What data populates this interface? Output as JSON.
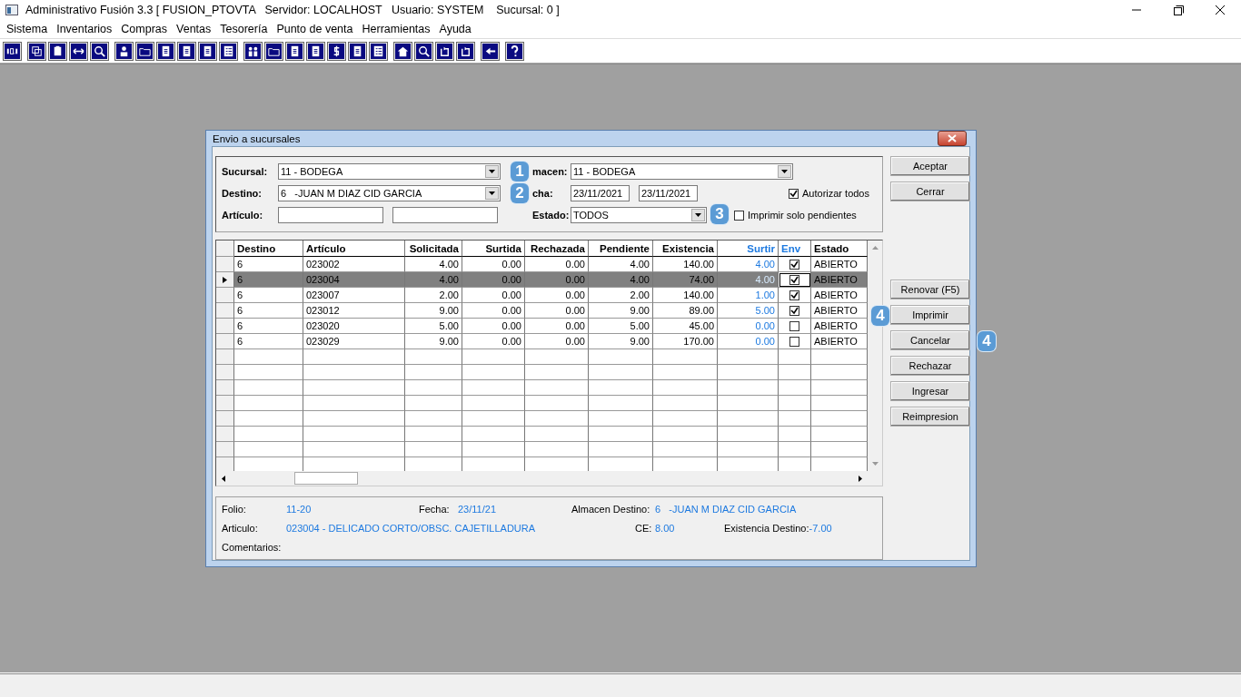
{
  "app_window": {
    "title": "Administrativo Fusión 3.3 [ FUSION_PTOVTA   Servidor: LOCALHOST   Usuario: SYSTEM    Sucursal: 0 ]"
  },
  "menu": [
    "Sistema",
    "Inventarios",
    "Compras",
    "Ventas",
    "Tesorería",
    "Punto de venta",
    "Herramientas",
    "Ayuda"
  ],
  "dialog": {
    "title": "Envio a sucursales",
    "filters": {
      "sucursal": {
        "label": "Sucursal:",
        "value": "11 - BODEGA"
      },
      "almacen": {
        "label": "macen:",
        "value": "11 - BODEGA",
        "badge": "1"
      },
      "destino": {
        "label": "Destino:",
        "value": "6   -JUAN M DIAZ CID GARCIA"
      },
      "fecha": {
        "label": "cha:",
        "from": "23/11/2021",
        "to": "23/11/2021",
        "badge": "2"
      },
      "articulo": {
        "label": "Artículo:"
      },
      "estado": {
        "label": "Estado:",
        "value": "TODOS"
      },
      "autorizar_todos": {
        "label": "Autorizar todos",
        "checked": true
      },
      "imprimir_pendientes": {
        "label": "Imprimir solo pendientes",
        "checked": false,
        "badge": "3"
      }
    },
    "columns": [
      {
        "label": "Destino",
        "kind": "plain"
      },
      {
        "label": "Artículo",
        "kind": "plain"
      },
      {
        "label": "Solicitada",
        "kind": "plain"
      },
      {
        "label": "Surtida",
        "kind": "plain"
      },
      {
        "label": "Rechazada",
        "kind": "plain"
      },
      {
        "label": "Pendiente",
        "kind": "plain"
      },
      {
        "label": "Existencia",
        "kind": "plain"
      },
      {
        "label": "Surtir",
        "kind": "editable"
      },
      {
        "label": "Env",
        "kind": "editable"
      },
      {
        "label": "Estado",
        "kind": "plain"
      }
    ],
    "rows": [
      {
        "selected": false,
        "cells": [
          "6",
          "023002",
          "4.00",
          "0.00",
          "0.00",
          "4.00",
          "140.00",
          "4.00"
        ],
        "env": true,
        "estado": "ABIERTO"
      },
      {
        "selected": true,
        "cells": [
          "6",
          "023004",
          "4.00",
          "0.00",
          "0.00",
          "4.00",
          "74.00",
          "4.00"
        ],
        "env": true,
        "estado": "ABIERTO"
      },
      {
        "selected": false,
        "cells": [
          "6",
          "023007",
          "2.00",
          "0.00",
          "0.00",
          "2.00",
          "140.00",
          "1.00"
        ],
        "env": true,
        "estado": "ABIERTO"
      },
      {
        "selected": false,
        "cells": [
          "6",
          "023012",
          "9.00",
          "0.00",
          "0.00",
          "9.00",
          "89.00",
          "5.00"
        ],
        "env": true,
        "estado": "ABIERTO"
      },
      {
        "selected": false,
        "cells": [
          "6",
          "023020",
          "5.00",
          "0.00",
          "0.00",
          "5.00",
          "45.00",
          "0.00"
        ],
        "env": false,
        "estado": "ABIERTO"
      },
      {
        "selected": false,
        "cells": [
          "6",
          "023029",
          "9.00",
          "0.00",
          "0.00",
          "9.00",
          "170.00",
          "0.00"
        ],
        "env": false,
        "estado": "ABIERTO"
      }
    ],
    "buttons_top": [
      {
        "label": "Aceptar"
      },
      {
        "label": "Cerrar"
      }
    ],
    "buttons": [
      {
        "label": "Renovar (F5)"
      },
      {
        "label": "Imprimir",
        "badge": "4"
      },
      {
        "label": "Cancelar",
        "badge": "4"
      },
      {
        "label": "Rechazar"
      },
      {
        "label": "Ingresar"
      },
      {
        "label": "Reimpresion"
      }
    ],
    "info": {
      "folio": {
        "label": "Folio:",
        "value": "11-20"
      },
      "fecha": {
        "label": "Fecha:",
        "value": "23/11/21"
      },
      "almacen_destino": {
        "label": "Almacen Destino:",
        "value": "6   -JUAN M DIAZ CID GARCIA"
      },
      "articulo": {
        "label": "Articulo:",
        "value": "023004 - DELICADO CORTO/OBSC. CAJETILLADURA"
      },
      "ce": {
        "label": "CE:",
        "value": "8.00"
      },
      "existencia_destino": {
        "label": "Existencia Destino:",
        "value": "-7.00"
      },
      "comentarios": {
        "label": "Comentarios:"
      }
    }
  }
}
